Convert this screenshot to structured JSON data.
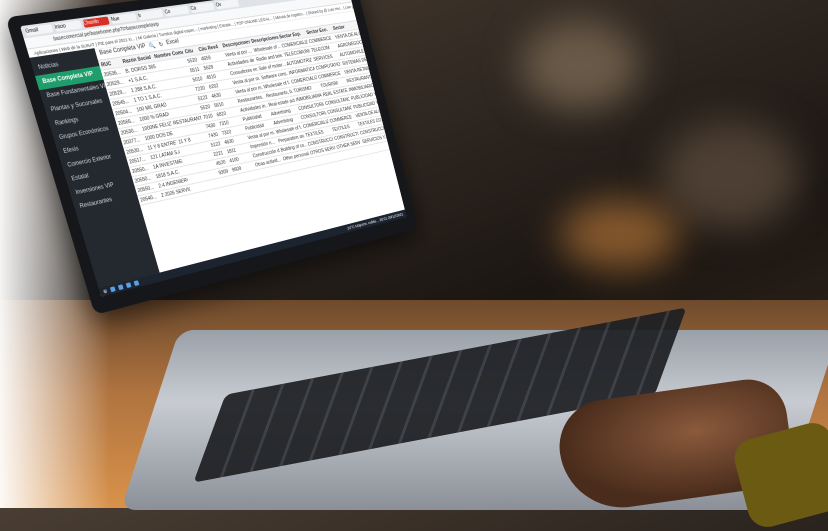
{
  "browser": {
    "tabs": [
      "Gmail",
      "Inicio",
      "Chanllo",
      "Nue",
      "Ir",
      "Co",
      "Ca",
      "Ov"
    ],
    "url": "basecomercial.pe/basehome.php?t=basecompletavip",
    "bookmarks": "Aplicaciones | Web de la SUNAT | PIE para el 2021 in... | Mi Galería | Turnitos digital espec... | marketing | Estrate... | TOP ONLINE LEGAL... | Minuta de registro... | Shared by @ Luis Her... | Live general - Ren..."
  },
  "app": {
    "sidebar": [
      {
        "label": "Noticias",
        "active": false
      },
      {
        "label": "Base Completa VIP",
        "active": true
      },
      {
        "label": "Base Fundamentales VIP",
        "active": false
      },
      {
        "label": "Plantas y Sucursales",
        "active": false
      },
      {
        "label": "Rankings",
        "active": false
      },
      {
        "label": "Grupos Económicos",
        "active": false
      },
      {
        "label": "Efesis",
        "active": false
      },
      {
        "label": "Comercio Exterior",
        "active": false
      },
      {
        "label": "Estatal",
        "active": false
      },
      {
        "label": "Inversiones VIP",
        "active": false
      },
      {
        "label": "Restaurantes",
        "active": false
      }
    ],
    "toolbar_label": "Excel",
    "breadcrumb": "Base Completa VIP",
    "columns": [
      "RUC",
      "Razón Social",
      "Nombre Comercial",
      "Ciiu",
      "Ciiu Rev4",
      "Descripciones",
      "Descripciones",
      "Sector Esp.",
      "Sector Eco.",
      "Sector"
    ],
    "rows": [
      [
        "20536...",
        "B. DORSS 365 S.A.C.",
        "",
        "5520",
        "4659",
        "Venta al por ...",
        "Wholesale of ...",
        "COMERCIALIZ...",
        "COMMERCE",
        "VENTA DE ALI..."
      ],
      [
        "20529...",
        "+1 S.A.C.",
        "",
        "5511",
        "5629",
        "Actividades de ...",
        "Radio and tele...",
        "TELECOMUNIC...",
        "TELECOM",
        "AGRONEGOCIO..."
      ],
      [
        "20529...",
        "1 288 S.A.C.",
        "",
        "5010",
        "4510",
        "Consultores en ...",
        "Sale of motor...",
        "AUTOMOTRIZ",
        "SERVICES",
        "AUTOMOVILES..."
      ],
      [
        "20545...",
        "1 TO 1 S.A.C.",
        "",
        "7220",
        "6202",
        "Venta al por m...",
        "Software cons...",
        "INFORMATICA",
        "COMPUTATION",
        "SISTEMAS DE..."
      ],
      [
        "20504...",
        "100 MIL GRADOS S.A.C.",
        "",
        "5122",
        "4630",
        "Venta al por m...",
        "Wholesale of f...",
        "COMERCIALIZ...",
        "COMMERCE",
        "VENTA RETAIL..."
      ],
      [
        "20566...",
        "1000 % GRADOS S.A.C.",
        "",
        "5520",
        "5610",
        "Restaurantes, ...",
        "Restaurants, b...",
        "TURISMO",
        "TOURISM",
        "RESTAURANTE..."
      ],
      [
        "20530...",
        "1000NE FELIZ S.A.C.",
        "RESTAURANT",
        "7010",
        "6810",
        "Actividades in...",
        "Real estate act...",
        "INMOBILIARIA",
        "REAL ESTATE",
        "INMOBILIARIO..."
      ],
      [
        "20377...",
        "1000 DOS DE MAYO S.A.C.",
        "",
        "7430",
        "7310",
        "Publicidad",
        "Advertising",
        "CONSULTORIA",
        "CONSULTANCY",
        "PUBLICIDAD Y..."
      ],
      [
        "20530...",
        "11 Y 8 ENTRETENIMIENTO...",
        "11 Y 8",
        "7430",
        "7310",
        "Publicidad",
        "Advertising",
        "CONSULTORIA",
        "CONSULTANCY",
        "PUBLICIDAD Y..."
      ],
      [
        "20517...",
        "121 LATAM S.A.C.",
        "",
        "5122",
        "4630",
        "Venta al por m...",
        "Wholesale of f...",
        "COMERCIALIZ...",
        "COMMERCE",
        "VENTA DE ALI..."
      ],
      [
        "20550...",
        "1A INVESTMENT SAC",
        "",
        "2221",
        "1811",
        "Impresión n...",
        "Preparation an...",
        "TEXTILES",
        "TEXTILES",
        "TEXTILES CO..."
      ],
      [
        "20550...",
        "1818 S.A.C.",
        "",
        "4520",
        "4100",
        "Construcción d...",
        "Building of co...",
        "CONSTRUCCI...",
        "CONSTRUCTION",
        "CONSTRUCCIO..."
      ],
      [
        "20550...",
        "2.4 INGENIERO S.A.C.",
        "",
        "9309",
        "9609",
        "Otras activid...",
        "Other personal...",
        "OTROS SERVI...",
        "OTHER SERVI...",
        "SERVICIOS Y..."
      ],
      [
        "20540...",
        "2 2026 SERVICES S.A.C.",
        "",
        "",
        "",
        "",
        "",
        "",
        "",
        ""
      ]
    ]
  },
  "taskbar": {
    "weather": "24°C  Mayorm. nubla...",
    "clock": "20:01",
    "date": "20/12/2021"
  }
}
